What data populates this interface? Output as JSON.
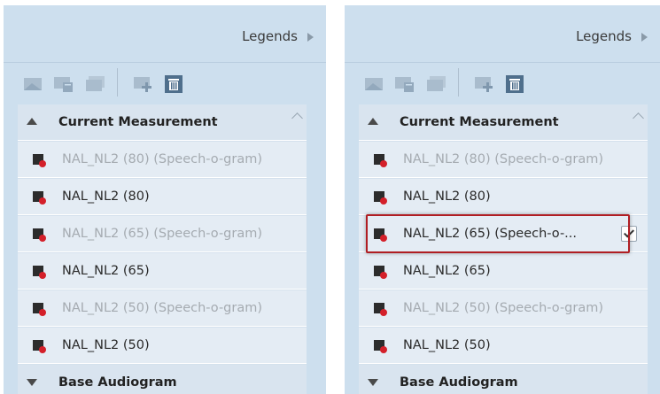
{
  "panels": [
    {
      "header": "Legends",
      "groups": {
        "current": "Current Measurement",
        "base": "Base Audiogram"
      },
      "rows": [
        {
          "label": "NAL_NL2 (80) (Speech-o-gram)",
          "state": "dim"
        },
        {
          "label": "NAL_NL2 (80)",
          "state": "normal"
        },
        {
          "label": "NAL_NL2 (65) (Speech-o-gram)",
          "state": "dim"
        },
        {
          "label": "NAL_NL2 (65)",
          "state": "normal"
        },
        {
          "label": "NAL_NL2 (50) (Speech-o-gram)",
          "state": "dim"
        },
        {
          "label": "NAL_NL2 (50)",
          "state": "normal"
        }
      ]
    },
    {
      "header": "Legends",
      "groups": {
        "current": "Current Measurement",
        "base": "Base Audiogram"
      },
      "rows": [
        {
          "label": "NAL_NL2 (80) (Speech-o-gram)",
          "state": "dim"
        },
        {
          "label": "NAL_NL2 (80)",
          "state": "normal"
        },
        {
          "label": "NAL_NL2 (65) (Speech-o-...",
          "state": "normal",
          "checked": true
        },
        {
          "label": "NAL_NL2 (65)",
          "state": "normal"
        },
        {
          "label": "NAL_NL2 (50) (Speech-o-gram)",
          "state": "dim"
        },
        {
          "label": "NAL_NL2 (50)",
          "state": "normal"
        }
      ]
    }
  ],
  "icons": {
    "toolbar": [
      "layer-icon",
      "layer-delete-icon",
      "layer-copy-icon",
      "layer-add-icon",
      "trash-icon"
    ],
    "legend": "legend-marker-icon",
    "header_arrow": "chevron-right-icon"
  },
  "colors": {
    "panel_bg": "#cddfee",
    "row_bg": "#e4ecf4",
    "marker_dot": "#d4202a",
    "highlight_border": "#b01e23"
  }
}
